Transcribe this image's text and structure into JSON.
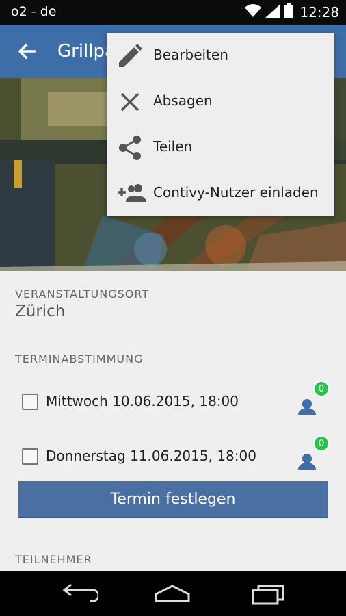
{
  "status_bar": {
    "carrier": "o2 - de",
    "time": "12:28"
  },
  "app_bar": {
    "title": "Grillpa"
  },
  "menu": {
    "items": [
      {
        "label": "Bearbeiten",
        "icon": "pencil-icon"
      },
      {
        "label": "Absagen",
        "icon": "close-icon"
      },
      {
        "label": "Teilen",
        "icon": "share-icon"
      },
      {
        "label": "Contivy-Nutzer einladen",
        "icon": "add-people-icon"
      }
    ]
  },
  "location": {
    "label": "VERANSTALTUNGSORT",
    "value": "Zürich"
  },
  "poll": {
    "label": "TERMINABSTIMMUNG",
    "options": [
      {
        "label": "Mittwoch 10.06.2015, 18:00",
        "votes": "0"
      },
      {
        "label": "Donnerstag 11.06.2015, 18:00",
        "votes": "0"
      }
    ],
    "button_label": "Termin festlegen"
  },
  "participants": {
    "label": "TEILNEHMER"
  },
  "colors": {
    "primary": "#3d6ea7",
    "button": "#4a6fa3",
    "badge": "#27c34a"
  }
}
